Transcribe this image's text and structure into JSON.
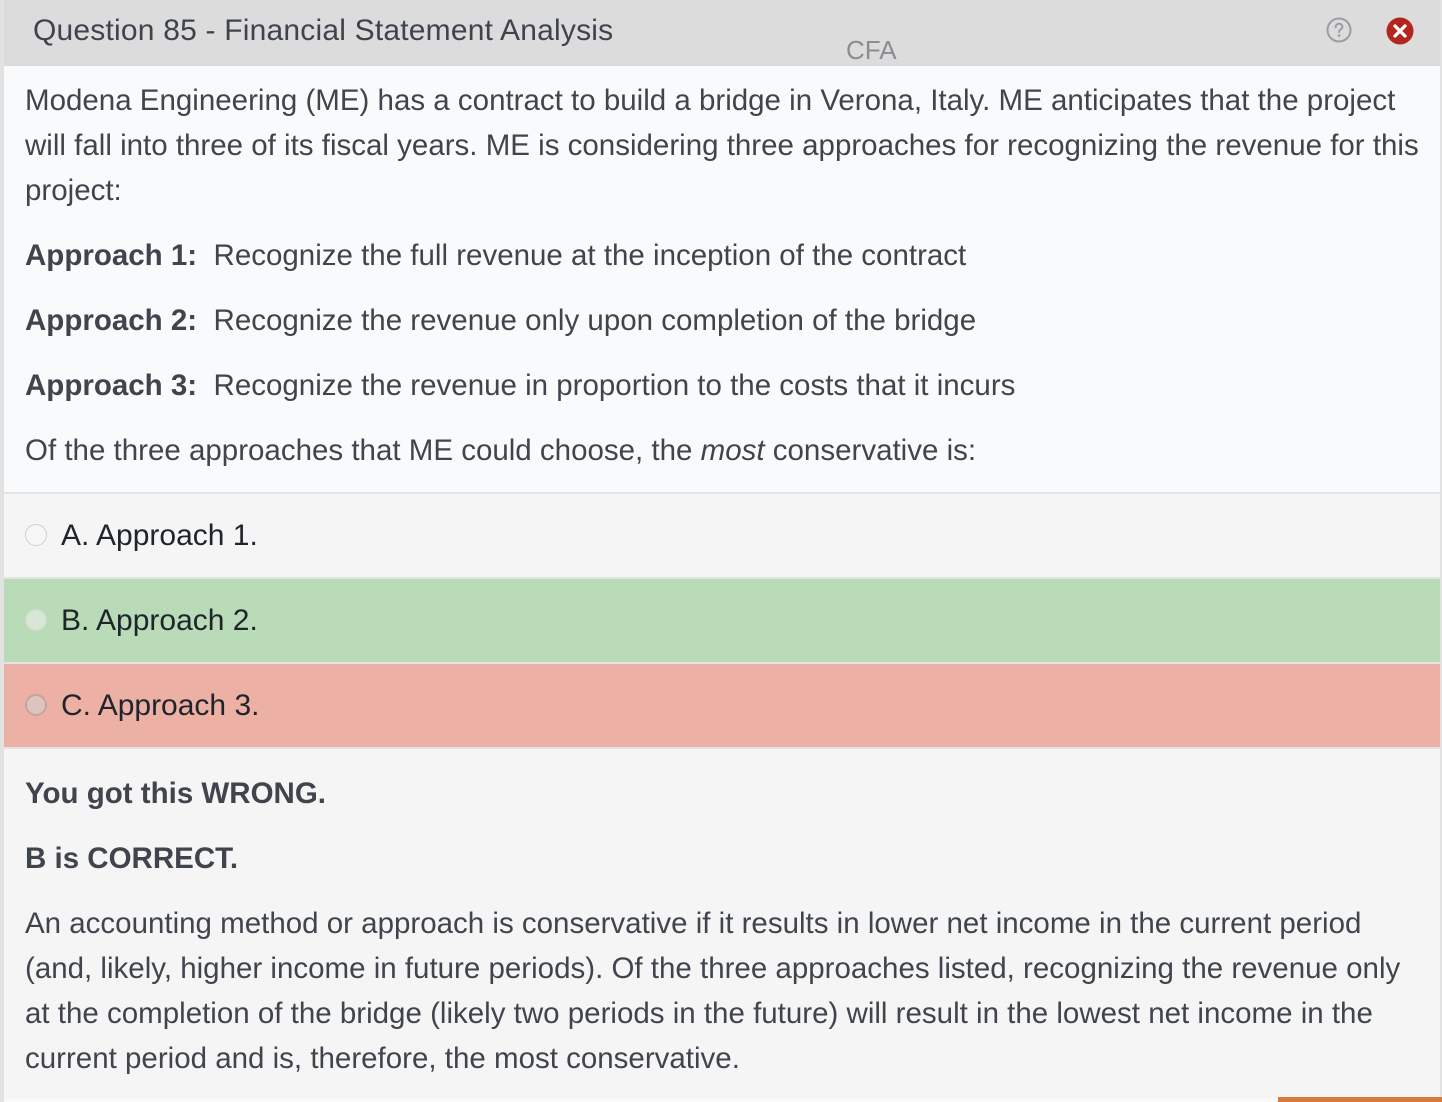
{
  "header": {
    "title": "Question 85 - Financial Statement Analysis",
    "badge": "CFA",
    "help_icon": "help-circle-icon",
    "close_icon": "close-circle-icon",
    "close_color": "#b3261e"
  },
  "question": {
    "stem": "Modena Engineering (ME) has a contract to build a bridge in Verona, Italy.  ME anticipates that the project will fall into three of its fiscal years.  ME is considering three approaches for recognizing the revenue for this project:",
    "approaches": [
      {
        "label": "Approach 1:",
        "text": "Recognize the full revenue at the inception of the contract"
      },
      {
        "label": "Approach 2:",
        "text": "Recognize the revenue only upon completion of the bridge"
      },
      {
        "label": "Approach 3:",
        "text": "Recognize the revenue in proportion to the costs that it incurs"
      }
    ],
    "prompt_before": "Of the three approaches that ME could choose, the ",
    "prompt_emphasis": "most",
    "prompt_after": " conservative is:"
  },
  "options": [
    {
      "letter": "A.",
      "text": "Approach 1.",
      "state": "neutral"
    },
    {
      "letter": "B.",
      "text": "Approach 2.",
      "state": "correct"
    },
    {
      "letter": "C.",
      "text": "Approach 3.",
      "state": "wrong"
    }
  ],
  "colors": {
    "correct_bg": "#b9dbb7",
    "wrong_bg": "#ecb0a5",
    "accent": "#d87a3a"
  },
  "feedback": {
    "status": "You got this WRONG.",
    "correct_answer": "B is CORRECT.",
    "explanation": "An accounting method or approach is conservative if it results in lower net income in the current period (and, likely, higher income in future periods).  Of the three approaches listed, recognizing the revenue only at the completion of the bridge (likely two periods in the future) will result in the lowest net income in the current period and is, therefore, the most conservative."
  }
}
